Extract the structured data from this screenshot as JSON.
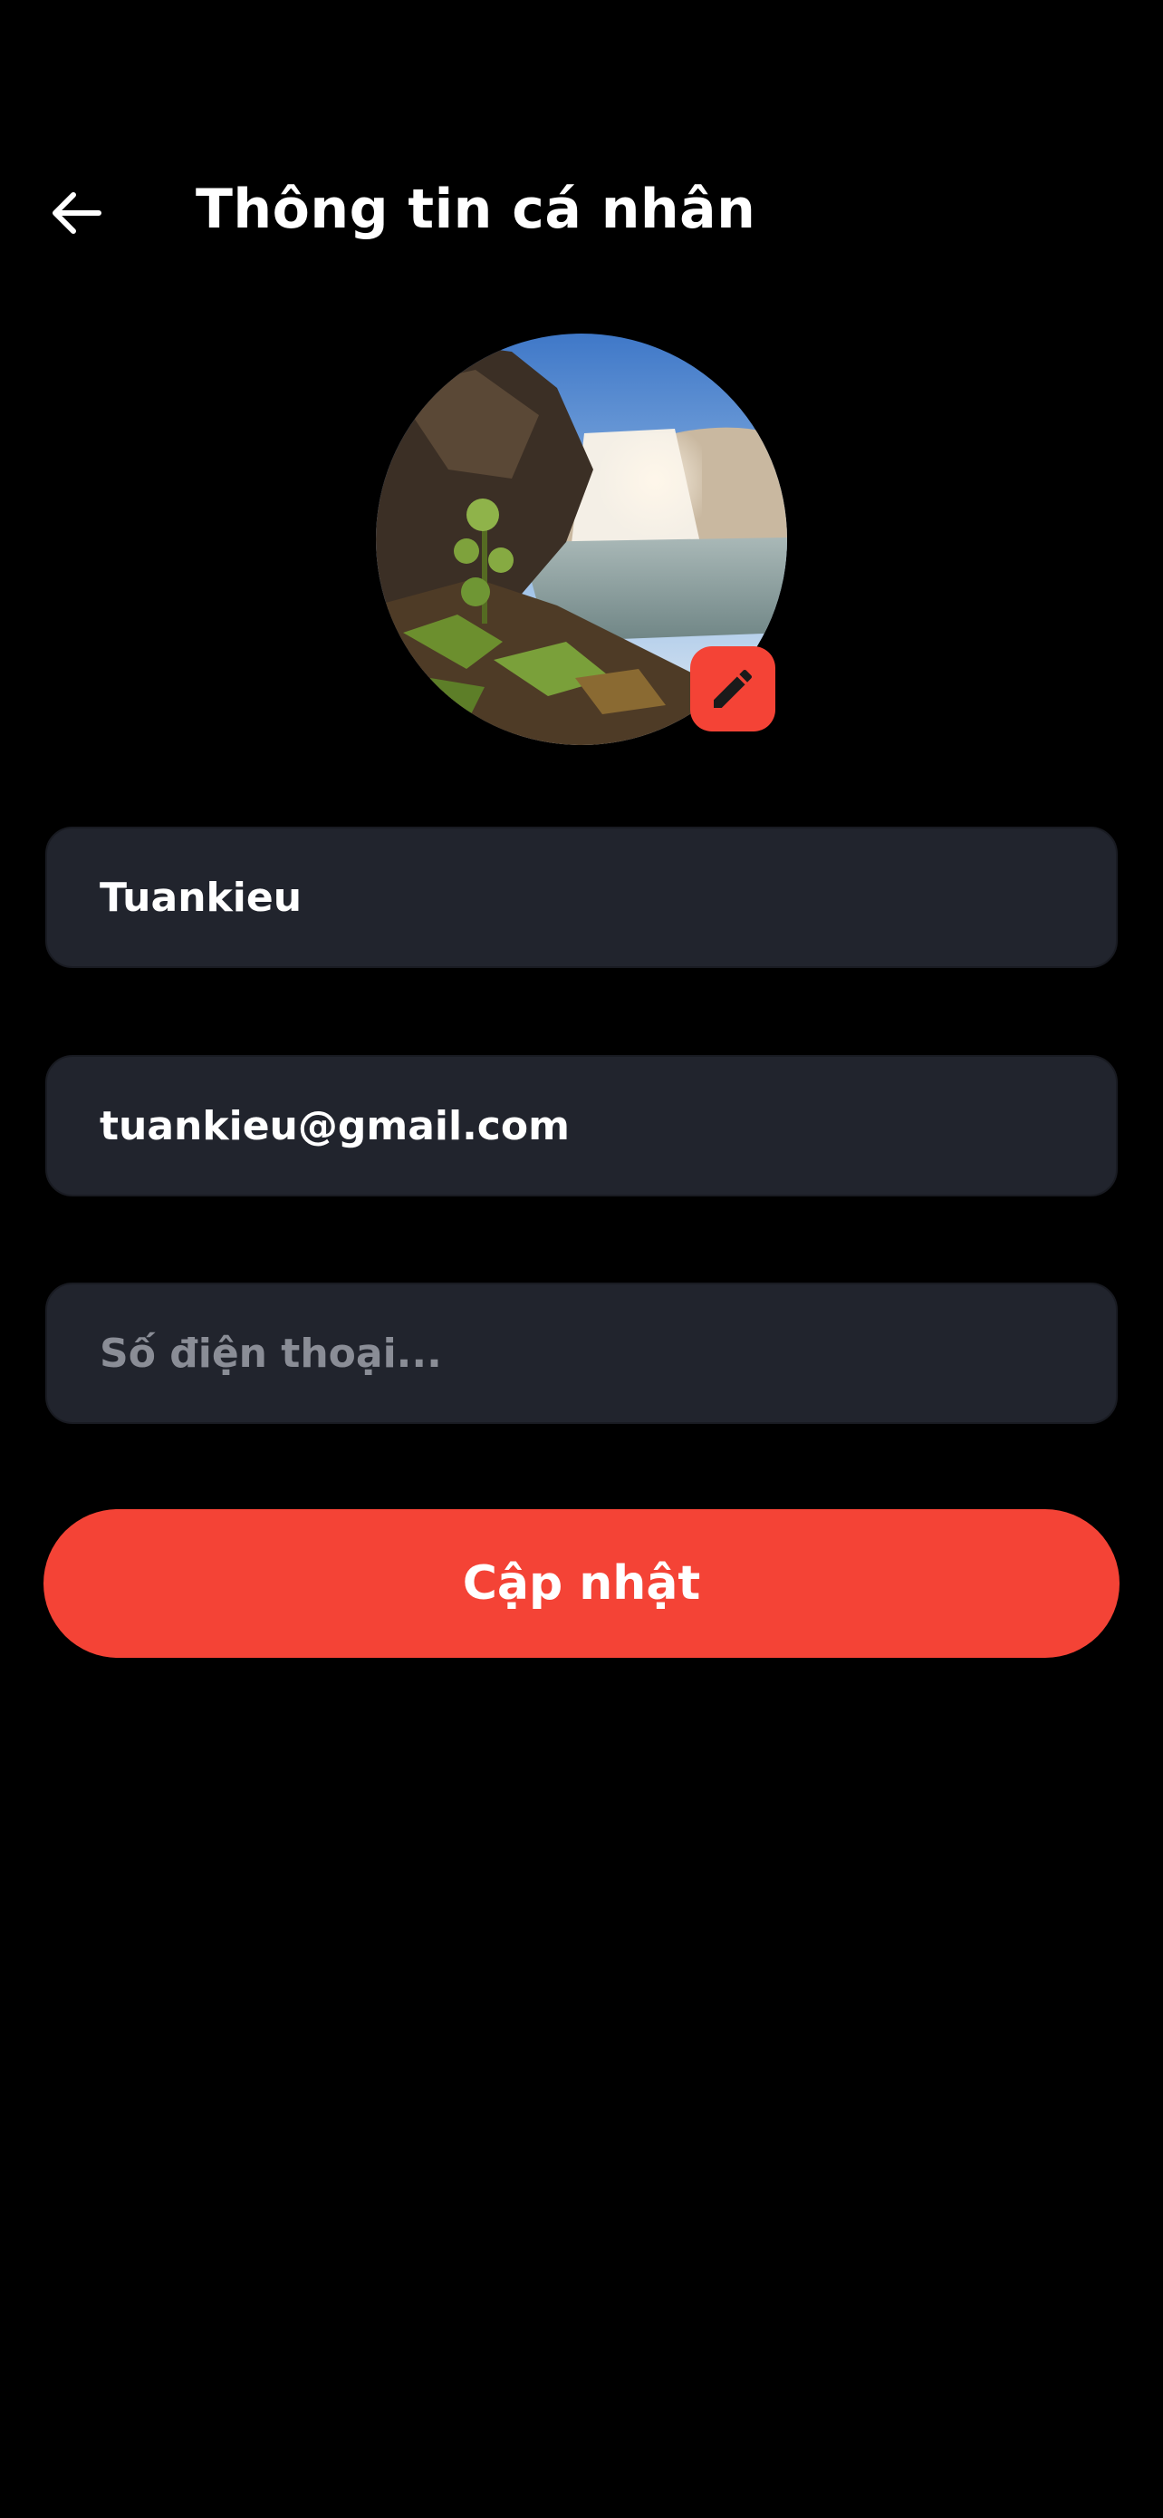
{
  "header": {
    "back_icon": "arrow-left-icon",
    "title": "Thông tin cá nhân"
  },
  "avatar": {
    "edit_icon": "pencil-icon",
    "edit_button_color": "#f44336"
  },
  "form": {
    "name_value": "Tuankieu",
    "email_value": "tuankieu@gmail.com",
    "phone_value": "",
    "phone_placeholder": "Số điện thoại..."
  },
  "actions": {
    "update_label": "Cập nhật"
  },
  "colors": {
    "background": "#000000",
    "field_background": "#21242d",
    "accent": "#f44336",
    "placeholder": "#8a8d96"
  }
}
